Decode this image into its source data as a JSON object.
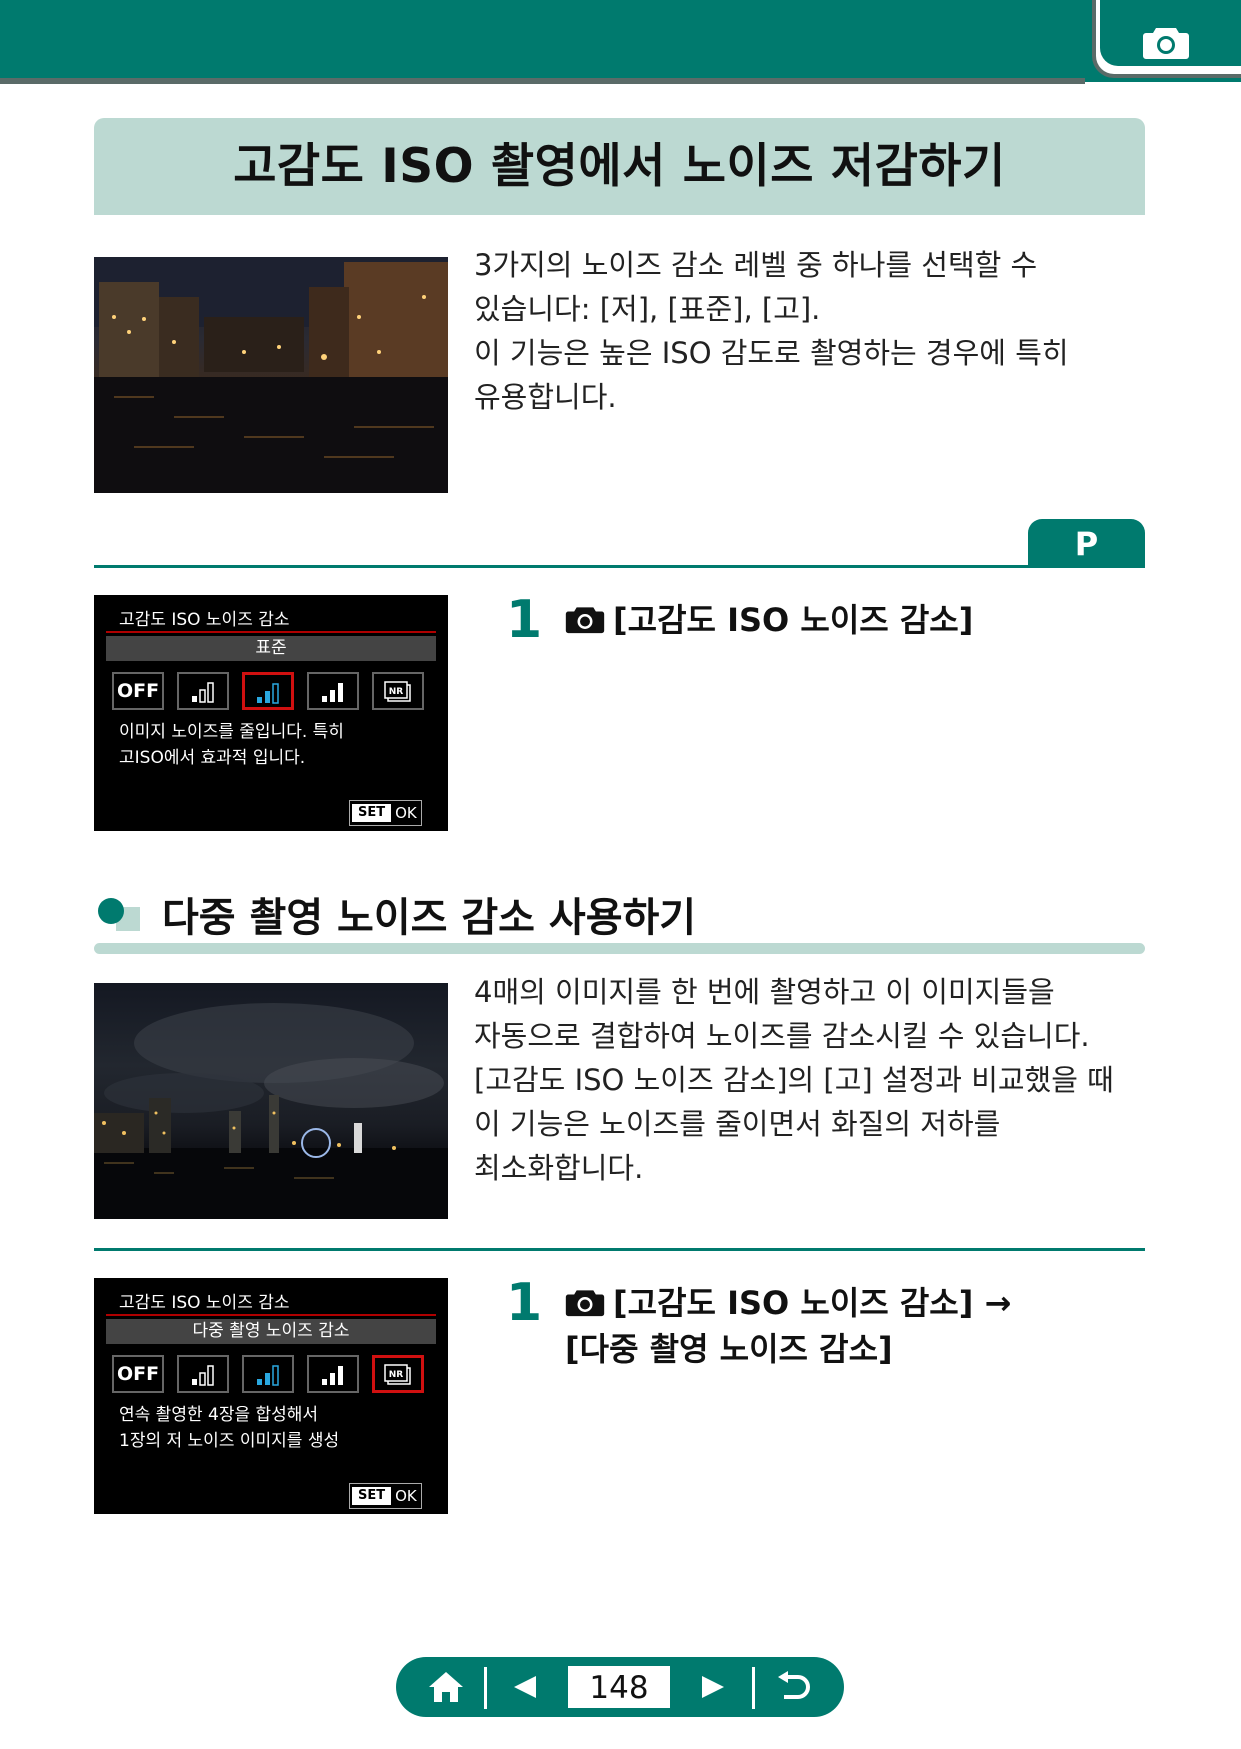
{
  "header": {
    "camera_icon": "camera-icon"
  },
  "title": "고감도 ISO 촬영에서 노이즈 저감하기",
  "intro": {
    "lines": [
      "3가지의 노이즈 감소 레벨 중 하나를 선택할 수",
      "있습니다: [저], [표준], [고].",
      "이 기능은 높은 ISO 감도로 촬영하는 경우에 특히",
      "유용합니다."
    ]
  },
  "mode_tab": "P",
  "step1": {
    "number": "1",
    "text": "[고감도 ISO 노이즈 감소]"
  },
  "screen1": {
    "title": "고감도 ISO 노이즈 감소",
    "selected": "표준",
    "options": [
      "OFF",
      "low",
      "standard",
      "high",
      "NR"
    ],
    "desc": [
      "이미지 노이즈를 줄입니다. 특히",
      "고ISO에서 효과적 입니다."
    ],
    "set": "SET",
    "ok": "OK"
  },
  "section": {
    "title": "다중 촬영 노이즈 감소 사용하기",
    "lines": [
      "4매의 이미지를 한 번에 촬영하고 이 이미지들을",
      "자동으로 결합하여 노이즈를 감소시킬 수 있습니다.",
      "[고감도 ISO 노이즈 감소]의 [고] 설정과 비교했을 때",
      "이 기능은 노이즈를 줄이면서 화질의 저하를",
      "최소화합니다."
    ]
  },
  "step2": {
    "number": "1",
    "line1": "[고감도 ISO 노이즈 감소] →",
    "line2": "[다중 촬영 노이즈 감소]"
  },
  "screen2": {
    "title": "고감도 ISO 노이즈 감소",
    "selected": "다중 촬영 노이즈 감소",
    "desc": [
      "연속 촬영한 4장을 합성해서",
      "1장의 저 노이즈 이미지를 생성"
    ],
    "set": "SET",
    "ok": "OK"
  },
  "nav": {
    "page": "148",
    "icons": [
      "home-icon",
      "prev-arrow-icon",
      "next-arrow-icon",
      "return-icon"
    ]
  }
}
